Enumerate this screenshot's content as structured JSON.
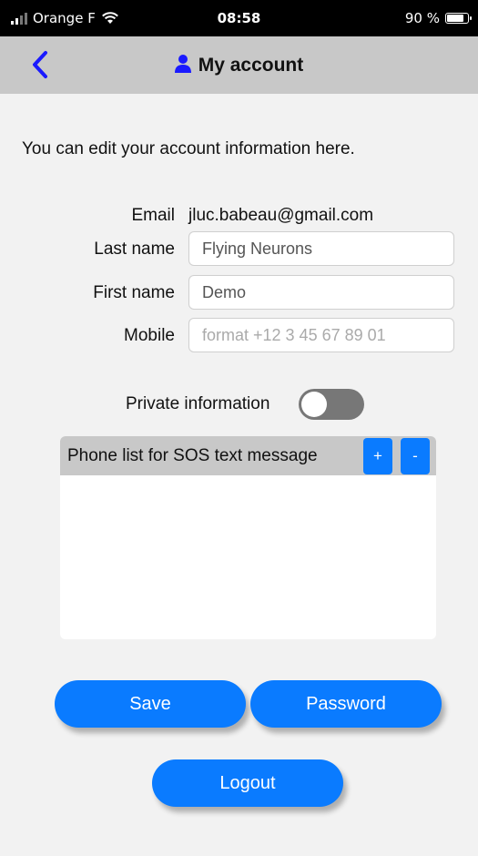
{
  "status_bar": {
    "carrier": "Orange F",
    "time": "08:58",
    "battery_percent": "90 %",
    "battery_level": 0.9
  },
  "nav": {
    "back_icon": "chevron-left-icon",
    "title_icon": "user-icon",
    "title": "My account"
  },
  "intro_text": "You can edit your account information here.",
  "form": {
    "email_label": "Email",
    "email_value": "jluc.babeau@gmail.com",
    "last_name_label": "Last name",
    "last_name_value": "Flying Neurons",
    "first_name_label": "First name",
    "first_name_value": "Demo",
    "mobile_label": "Mobile",
    "mobile_placeholder": "format +12 3 45 67 89 01",
    "mobile_value": ""
  },
  "private_info": {
    "label": "Private information",
    "enabled": false
  },
  "phone_list": {
    "title": "Phone list for SOS text message",
    "add_label": "+",
    "remove_label": "-",
    "items": []
  },
  "buttons": {
    "save": "Save",
    "password": "Password",
    "logout": "Logout"
  },
  "colors": {
    "accent": "#0a7bff",
    "nav_background": "#c8c8c8",
    "page_background": "#f2f2f2",
    "toggle_off": "#777777"
  }
}
